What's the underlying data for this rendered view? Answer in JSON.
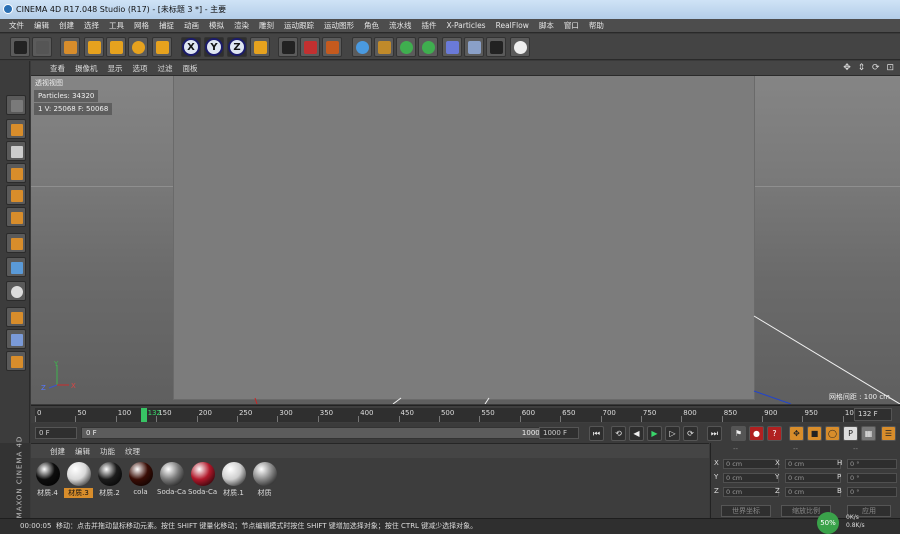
{
  "window": {
    "title": "CINEMA 4D R17.048 Studio (R17) - [未标题 3 *] - 主要"
  },
  "menubar": {
    "items": [
      "文件",
      "编辑",
      "创建",
      "选择",
      "工具",
      "网格",
      "捕捉",
      "动画",
      "模拟",
      "渲染",
      "雕刻",
      "运动跟踪",
      "运动图形",
      "角色",
      "流水线",
      "插件",
      "X-Particles",
      "RealFlow",
      "脚本",
      "窗口",
      "帮助"
    ]
  },
  "toolbar": {
    "tools": [
      {
        "name": "undo-icon"
      },
      {
        "name": "redo-icon"
      },
      {
        "name": "live-select-icon"
      },
      {
        "name": "move-icon"
      },
      {
        "name": "scale-icon"
      },
      {
        "name": "rotate-icon"
      },
      {
        "name": "add-icon"
      },
      {
        "name": "x-axis-icon"
      },
      {
        "name": "y-axis-icon"
      },
      {
        "name": "z-axis-icon"
      },
      {
        "name": "coordinate-system-icon"
      },
      {
        "name": "render-view-icon"
      },
      {
        "name": "render-picture-viewer-icon"
      },
      {
        "name": "render-settings-icon"
      },
      {
        "name": "cube-icon"
      },
      {
        "name": "pen-icon"
      },
      {
        "name": "subdivision-icon"
      },
      {
        "name": "array-icon"
      },
      {
        "name": "deformer-icon"
      },
      {
        "name": "floor-icon"
      },
      {
        "name": "camera-icon"
      },
      {
        "name": "light-icon"
      }
    ],
    "axis_labels": [
      "X",
      "Y",
      "Z"
    ]
  },
  "left_tools": [
    "model-mode-icon",
    "object-mode-icon",
    "texture-mode-icon",
    "points-mode-icon",
    "edges-mode-icon",
    "polygons-mode-icon",
    "axis-mode-icon",
    "tweak-mode-icon",
    "snap-icon",
    "magnet-icon",
    "workplane-icon",
    "lock-icon"
  ],
  "viewport": {
    "menu": [
      "查看",
      "摄像机",
      "显示",
      "选项",
      "过滤",
      "面板"
    ],
    "label": "透视视图",
    "hud_particles": "Particles: 34320",
    "hud_stats": "1 V: 25068 F: 50068",
    "grid_info": "网格间距 : 100 cm",
    "axis": {
      "x": "X",
      "y": "Y",
      "z": "Z"
    },
    "nav_icons": "✥ ⇕ ⟳ ⊡"
  },
  "timeline": {
    "ticks": [
      "0",
      "50",
      "100",
      "150",
      "200",
      "250",
      "300",
      "350",
      "400",
      "450",
      "500",
      "550",
      "600",
      "650",
      "700",
      "750",
      "800",
      "850",
      "900",
      "950",
      "100"
    ],
    "current_frame_label": "132",
    "current_frame": 132,
    "max_frame": 1000,
    "end_label": "132 F"
  },
  "transport": {
    "start_field": "0 F",
    "range_start": "0 F",
    "range_end": "1000 F",
    "end_field": "1000 F",
    "buttons": [
      "⏮",
      "⟲",
      "◀",
      "▶",
      "▷",
      "⟳",
      "⏭"
    ]
  },
  "materials": {
    "menu": [
      "创建",
      "编辑",
      "功能",
      "纹理"
    ],
    "items": [
      {
        "label": "材质.4",
        "color": "#0d0d0d",
        "selected": false
      },
      {
        "label": "材质.3",
        "color": "#d9d9d9",
        "selected": true
      },
      {
        "label": "材质.2",
        "color": "#1c1c1c",
        "selected": false
      },
      {
        "label": "cola",
        "color": "#3a0d05",
        "selected": false
      },
      {
        "label": "Soda-Ca",
        "color": "#7a7a7a",
        "selected": false
      },
      {
        "label": "Soda-Ca",
        "color": "#b0182a",
        "selected": false
      },
      {
        "label": "材质.1",
        "color": "#cfcfcf",
        "selected": false
      },
      {
        "label": "材质",
        "color": "#8a8a8a",
        "selected": false
      }
    ]
  },
  "coordinates": {
    "header": [
      "--",
      "--",
      "--"
    ],
    "rows": [
      {
        "axis": "X",
        "pos": "0 cm",
        "axis2": "X",
        "size": "0 cm",
        "axis3": "H",
        "rot": "0 °"
      },
      {
        "axis": "Y",
        "pos": "0 cm",
        "axis2": "Y",
        "size": "0 cm",
        "axis3": "P",
        "rot": "0 °"
      },
      {
        "axis": "Z",
        "pos": "0 cm",
        "axis2": "Z",
        "size": "0 cm",
        "axis3": "B",
        "rot": "0 °"
      }
    ],
    "world_button": "世界坐标",
    "scale_button": "缩放比例",
    "apply_button": "应用"
  },
  "branding": {
    "maxon": "MAXON CINEMA 4D"
  },
  "status": {
    "time": "00:00:05",
    "message": "移动：点击并拖动鼠标移动元素。按住 SHIFT 键量化移动；节点编辑模式时按住 SHIFT 键增加选择对象；按住 CTRL 键减少选择对象。",
    "cpu": "50%",
    "net_up": "0K/s",
    "net_down": "0.8K/s"
  }
}
